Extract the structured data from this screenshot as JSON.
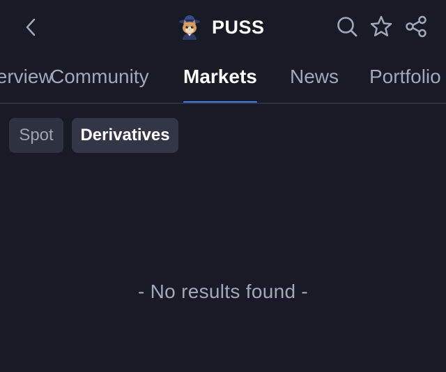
{
  "header": {
    "title": "PUSS",
    "back_icon": "chevron-left-icon",
    "avatar_icon": "cat-avatar-icon",
    "actions": [
      "search-icon",
      "star-icon",
      "share-icon"
    ]
  },
  "tabs": [
    {
      "label": "Overview",
      "active": false
    },
    {
      "label": "Community",
      "active": false
    },
    {
      "label": "Markets",
      "active": true
    },
    {
      "label": "News",
      "active": false
    },
    {
      "label": "Portfolio",
      "active": false
    }
  ],
  "subtabs": [
    {
      "label": "Spot",
      "active": false
    },
    {
      "label": "Derivatives",
      "active": true
    }
  ],
  "empty_state": {
    "message": "- No results found -"
  },
  "colors": {
    "background": "#181b26",
    "accent": "#3e7bf2",
    "chip": "#2d3140",
    "text_muted": "#a3a8b8"
  }
}
